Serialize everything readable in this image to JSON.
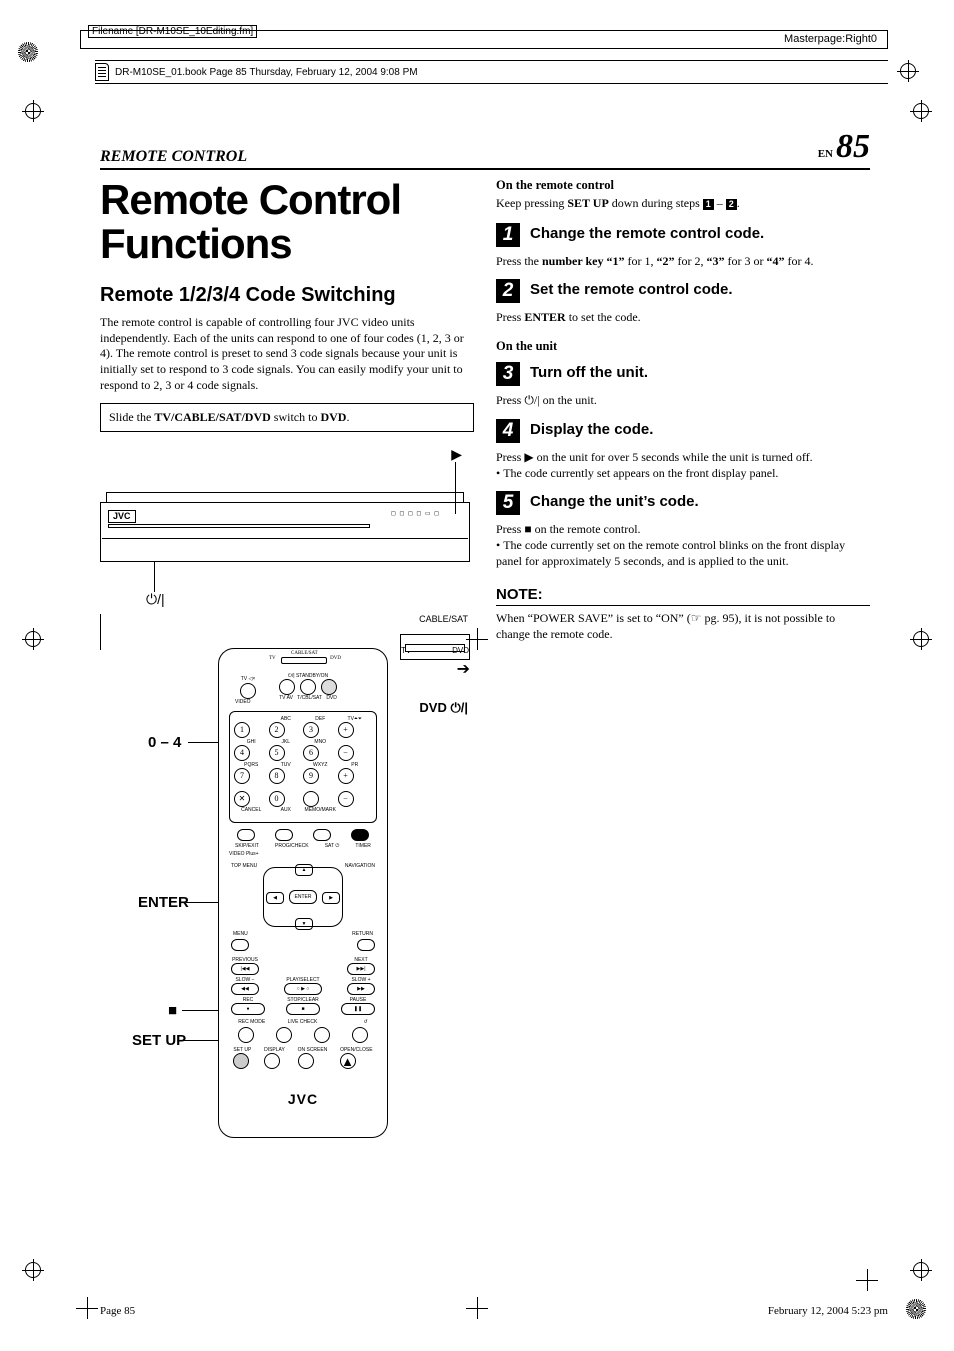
{
  "meta": {
    "filename_label": "Filename [DR-M10SE_10Editing.fm]",
    "masterpage": "Masterpage:Right0",
    "book_line": "DR-M10SE_01.book  Page 85  Thursday, February 12, 2004  9:08 PM"
  },
  "header": {
    "section": "REMOTE CONTROL",
    "lang": "EN",
    "page_number": "85"
  },
  "left": {
    "title": "Remote Control Functions",
    "subheading": "Remote 1/2/3/4 Code Switching",
    "intro": "The remote control is capable of controlling four JVC video units independently. Each of the units can respond to one of four codes (1, 2, 3 or 4). The remote control is preset to send 3 code signals because your unit is initially set to respond to 3 code signals. You can easily modify your unit to respond to 2, 3 or 4 code signals.",
    "slide_pre": "Slide the ",
    "slide_bold": "TV/CABLE/SAT/DVD",
    "slide_mid": " switch to ",
    "slide_bold2": "DVD",
    "slide_end": ".",
    "jvc": "JVC",
    "power_symbol": "⏻/|"
  },
  "callouts": {
    "cablesat": "CABLE/SAT",
    "tv": "TV",
    "dvd": "DVD",
    "dvd_power": "DVD ⏻/|",
    "range": "0 – 4",
    "enter": "ENTER",
    "stop": "■",
    "setup": "SET UP"
  },
  "remote_labels": {
    "top_row": [
      "TV AV",
      "T/CBL/SAT",
      "DVD"
    ],
    "standby": "⏻/| STANDBY/ON",
    "video": "VIDEO",
    "tv_mute": "TV ◁×",
    "numbers": [
      "1",
      "2",
      "3",
      "4",
      "5",
      "6",
      "7",
      "8",
      "9",
      "0"
    ],
    "num_letters": [
      "",
      "ABC",
      "DEF",
      "GHI",
      "JKL",
      "MNO",
      "PQRS",
      "TUV",
      "WXYZ",
      ""
    ],
    "tv_vol": "TV⏶⏷",
    "pr": "PR",
    "cancel": "CANCEL",
    "aux": "AUX",
    "memo": "MEMO/MARK",
    "row_small": [
      "SKIP/EXIT",
      "PROG/CHECK",
      "SAT ⏻",
      "TIMER"
    ],
    "vidplus": "VIDEO Plus+",
    "topmenu": "TOP MENU",
    "navigation": "NAVIGATION",
    "menu": "MENU",
    "return": "RETURN",
    "enter": "ENTER",
    "previous": "PREVIOUS",
    "next": "NEXT",
    "slow_minus": "SLOW −",
    "playselect": "PLAY/SELECT",
    "slow_plus": "SLOW +",
    "rec": "REC",
    "stopclear": "STOP/CLEAR",
    "pause": "PAUSE",
    "bottom_row1": [
      "REC MODE",
      "LIVE CHECK",
      "",
      ""
    ],
    "bottom_row2": [
      "SET UP",
      "DISPLAY",
      "ON SCREEN",
      "OPEN/CLOSE"
    ],
    "jvc": "JVC"
  },
  "right": {
    "on_remote": "On the remote control",
    "keep_press_pre": "Keep pressing ",
    "keep_press_bold": "SET UP",
    "keep_press_mid": " down during steps ",
    "keep_press_end": ".",
    "step1": {
      "num": "1",
      "title": "Change the remote control code.",
      "body_pre": "Press the ",
      "body_b1": "number key “1”",
      "body_m1": " for 1, ",
      "body_b2": "“2”",
      "body_m2": " for 2, ",
      "body_b3": "“3”",
      "body_m3": " for 3 or ",
      "body_b4": "“4”",
      "body_m4": " for 4."
    },
    "step2": {
      "num": "2",
      "title": "Set the remote control code.",
      "body_pre": "Press ",
      "body_b": "ENTER",
      "body_post": " to set the code."
    },
    "on_unit": "On the unit",
    "step3": {
      "num": "3",
      "title": "Turn off the unit.",
      "body": "Press ⏻/| on the unit."
    },
    "step4": {
      "num": "4",
      "title": "Display the code.",
      "body1": "Press ▶ on the unit for over 5 seconds while the unit is turned off.",
      "bullet": "The code currently set appears on the front display panel."
    },
    "step5": {
      "num": "5",
      "title": "Change the unit’s code.",
      "body1": "Press ■ on the remote control.",
      "bullet": "The code currently set on the remote control blinks on the front display panel for approximately 5 seconds, and is applied to the unit."
    },
    "note_hd": "NOTE:",
    "note_body": "When “POWER SAVE” is set to “ON” (☞ pg. 95), it is not possible to change the remote code."
  },
  "footer": {
    "left": "Page 85",
    "right": "February 12, 2004 5:23 pm"
  },
  "icons": {
    "play": "▶"
  }
}
